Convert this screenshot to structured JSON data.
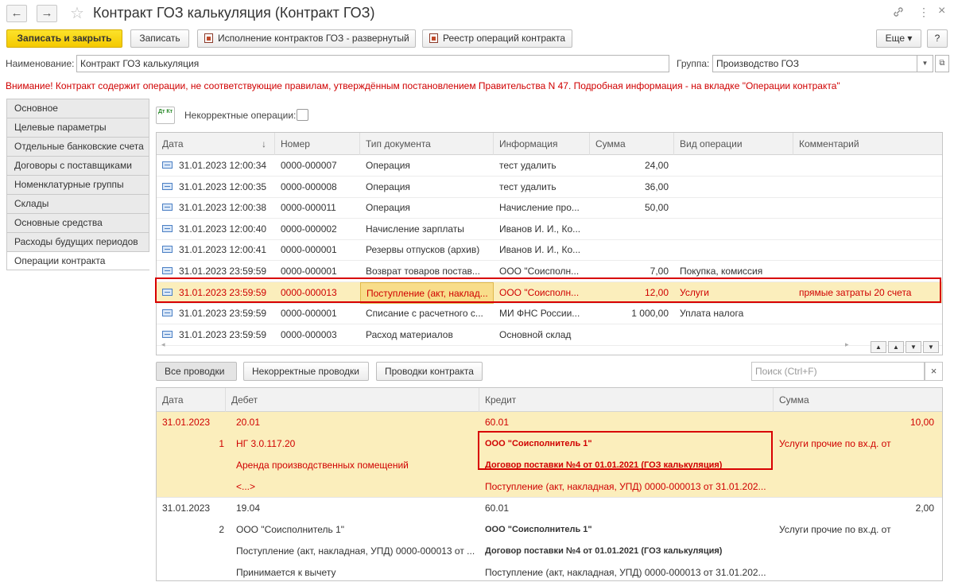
{
  "window": {
    "title": "Контракт ГОЗ калькуляция (Контракт ГОЗ)",
    "back_glyph": "←",
    "forward_glyph": "→",
    "star_glyph": "☆",
    "link_glyph": "🔗",
    "menu_glyph": "⋮",
    "close_glyph": "×"
  },
  "toolbar": {
    "save_close": "Записать и закрыть",
    "save": "Записать",
    "exec_report": "Исполнение контрактов ГОЗ - развернутый",
    "registry": "Реестр операций контракта",
    "more": "Еще ▾",
    "help": "?"
  },
  "form": {
    "name_label": "Наименование:",
    "name_value": "Контракт ГОЗ калькуляция",
    "group_label": "Группа:",
    "group_value": "Производство ГОЗ",
    "warning": "Внимание! Контракт содержит операции, не соответствующие правилам, утверждённым постановлением Правительства N 47. Подробная информация - на вкладке \"Операции контракта\""
  },
  "tabs": [
    "Основное",
    "Целевые параметры",
    "Отдельные банковские счета",
    "Договоры с поставщиками",
    "Номенклатурные группы",
    "Склады",
    "Основные средства",
    "Расходы будущих периодов",
    "Операции контракта"
  ],
  "ops": {
    "dtkt_icon": "Дт Кт",
    "incorrect_label": "Некорректные операции:",
    "columns": [
      "Дата",
      "Номер",
      "Тип документа",
      "Информация",
      "Сумма",
      "Вид операции",
      "Комментарий"
    ],
    "sort_arrow": "↓",
    "rows": [
      {
        "date": "31.01.2023 12:00:34",
        "num": "0000-000007",
        "type": "Операция",
        "info": "тест удалить",
        "sum": "24,00",
        "op": "",
        "comment": ""
      },
      {
        "date": "31.01.2023 12:00:35",
        "num": "0000-000008",
        "type": "Операция",
        "info": "тест удалить",
        "sum": "36,00",
        "op": "",
        "comment": ""
      },
      {
        "date": "31.01.2023 12:00:38",
        "num": "0000-000011",
        "type": "Операция",
        "info": "Начисление про...",
        "sum": "50,00",
        "op": "",
        "comment": ""
      },
      {
        "date": "31.01.2023 12:00:40",
        "num": "0000-000002",
        "type": "Начисление зарплаты",
        "info": "Иванов И. И., Ко...",
        "sum": "",
        "op": "",
        "comment": ""
      },
      {
        "date": "31.01.2023 12:00:41",
        "num": "0000-000001",
        "type": "Резервы отпусков (архив)",
        "info": "Иванов И. И., Ко...",
        "sum": "",
        "op": "",
        "comment": ""
      },
      {
        "date": "31.01.2023 23:59:59",
        "num": "0000-000001",
        "type": "Возврат товаров постав...",
        "info": "ООО \"Соисполн...",
        "sum": "7,00",
        "op": "Покупка, комиссия",
        "comment": ""
      },
      {
        "date": "31.01.2023 23:59:59",
        "num": "0000-000013",
        "type": "Поступление (акт, наклад...",
        "info": "ООО \"Соисполн...",
        "sum": "12,00",
        "op": "Услуги",
        "comment": "прямые затраты 20 счета"
      },
      {
        "date": "31.01.2023 23:59:59",
        "num": "0000-000001",
        "type": "Списание с расчетного с...",
        "info": "МИ ФНС России...",
        "sum": "1 000,00",
        "op": "Уплата налога",
        "comment": ""
      },
      {
        "date": "31.01.2023 23:59:59",
        "num": "0000-000003",
        "type": "Расход материалов",
        "info": "Основной склад",
        "sum": "",
        "op": "",
        "comment": ""
      }
    ]
  },
  "postings": {
    "btn_all": "Все проводки",
    "btn_incorrect": "Некорректные проводки",
    "btn_contract": "Проводки контракта",
    "search_placeholder": "Поиск (Ctrl+F)",
    "search_clear": "×",
    "columns": [
      "Дата",
      "Дебет",
      "Кредит",
      "Сумма"
    ],
    "entries": [
      {
        "date": "31.01.2023",
        "index": "1",
        "debit": "20.01",
        "credit": "60.01",
        "sum": "10,00",
        "debit_lines": [
          "НГ 3.0.117.20",
          "Аренда производственных помещений",
          "<...>"
        ],
        "credit_lines": [
          "ООО \"Соисполнитель 1\"",
          "Договор поставки №4 от 01.01.2021 (ГОЗ калькуляция)",
          "Поступление (акт, накладная, УПД) 0000-000013 от 31.01.202..."
        ],
        "content": "Услуги прочие по вх.д.  от"
      },
      {
        "date": "31.01.2023",
        "index": "2",
        "debit": "19.04",
        "credit": "60.01",
        "sum": "2,00",
        "debit_lines": [
          "ООО \"Соисполнитель 1\"",
          "Поступление (акт, накладная, УПД) 0000-000013 от ...",
          "Принимается к вычету"
        ],
        "credit_lines": [
          "ООО \"Соисполнитель 1\"",
          "Договор поставки №4 от 01.01.2021 (ГОЗ калькуляция)",
          "Поступление (акт, накладная, УПД) 0000-000013 от 31.01.202..."
        ],
        "content": "Услуги прочие по вх.д.  от"
      }
    ]
  },
  "colors": {
    "accent": "#f4c900",
    "highlight_row": "#fbeebc",
    "warning_text": "#d00000",
    "annotation_box": "#d80000"
  }
}
